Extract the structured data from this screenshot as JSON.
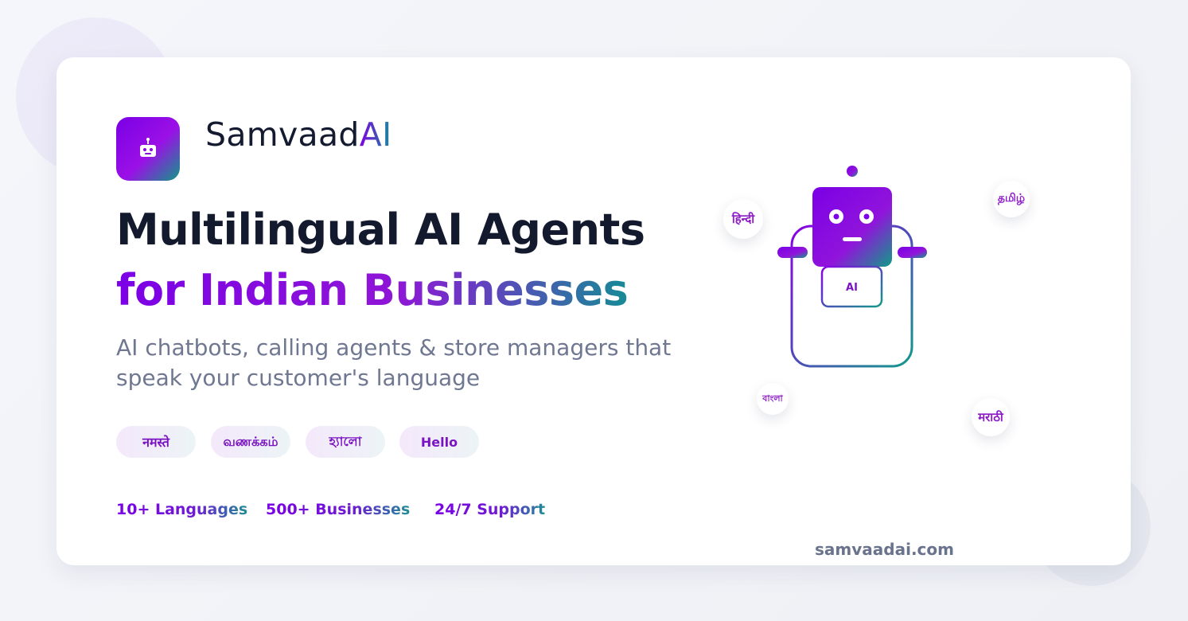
{
  "brand": {
    "name": "Samvaad",
    "name_accent": "AI",
    "logo_icon": "robot-icon"
  },
  "hero": {
    "headline_line1": "Multilingual AI Agents",
    "headline_line2": "for Indian Businesses",
    "subheadline": "AI chatbots, calling agents & store managers that speak your customer's language"
  },
  "greetings": [
    "नमस्ते",
    "வணக்கம்",
    "হ্যালো",
    "Hello"
  ],
  "stats": [
    "10+ Languages",
    "500+ Businesses",
    "24/7 Support"
  ],
  "footer": {
    "website": "samvaadai.com"
  },
  "illustration": {
    "robot_chest_label": "AI",
    "language_bubbles": {
      "hindi": "हिन्दी",
      "tamil": "தமிழ்",
      "bengali": "বাংলা",
      "marathi": "मराठी"
    }
  },
  "colors": {
    "primary_purple": "#7b00e6",
    "accent_teal": "#168b96",
    "headline_dark": "#131a2e",
    "muted_text": "#6f7791",
    "card_background": "#ffffff",
    "page_background": "#f2f4f8"
  }
}
